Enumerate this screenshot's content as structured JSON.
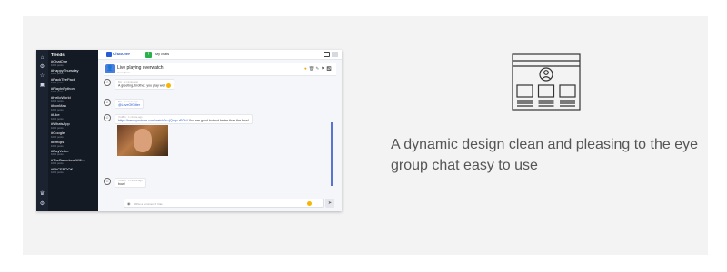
{
  "app": {
    "logo_label": "ChatOne",
    "tab_label": "My chats",
    "trends_title": "Trends",
    "trends": [
      {
        "tag": "#ChatOne",
        "count": "1000 posts"
      },
      {
        "tag": "#HappyThursday",
        "count": "1000 posts"
      },
      {
        "tag": "#PackThePack",
        "count": "1000 posts"
      },
      {
        "tag": "#PlayInPython",
        "count": "1000 posts"
      },
      {
        "tag": "#HelloWorld",
        "count": "1000 posts"
      },
      {
        "tag": "#IronMan",
        "count": "1000 posts"
      },
      {
        "tag": "#Like",
        "count": "1000 posts"
      },
      {
        "tag": "#WhatsApp",
        "count": "1000 posts"
      },
      {
        "tag": "#Google",
        "count": "1000 posts"
      },
      {
        "tag": "#Emojis",
        "count": "1000 posts"
      },
      {
        "tag": "#DayVetter",
        "count": "1000 posts"
      },
      {
        "tag": "#TheBarcelonaWill...",
        "count": "1000 posts"
      },
      {
        "tag": "#FACEBOOK",
        "count": "1000 posts"
      }
    ],
    "chat": {
      "name": "Live playing overwatch",
      "subtitle": "2 members"
    },
    "messages": [
      {
        "who": "Bot · 1 minute ago",
        "text": "A greeting, brother, you play well"
      },
      {
        "who": "Bot · 1 minute ago",
        "text": "@LoveOfGitter"
      },
      {
        "who": "YouBro · 1 minute ago",
        "link": "https://www.youtube.com/watch?v=jQcqo-rFGk4",
        "text": " You are good but not better than the bow!"
      },
      {
        "who": "YouBro · 1 minute ago",
        "text": "bow!"
      }
    ],
    "composer_placeholder": "Write a comment if I like"
  },
  "tagline": "A dynamic design clean and pleasing to the eye group chat easy to use",
  "colors": {
    "background": "#f3f3f3",
    "sidebar": "#141a24",
    "accent": "#2a5bd7",
    "text": "#555555"
  }
}
